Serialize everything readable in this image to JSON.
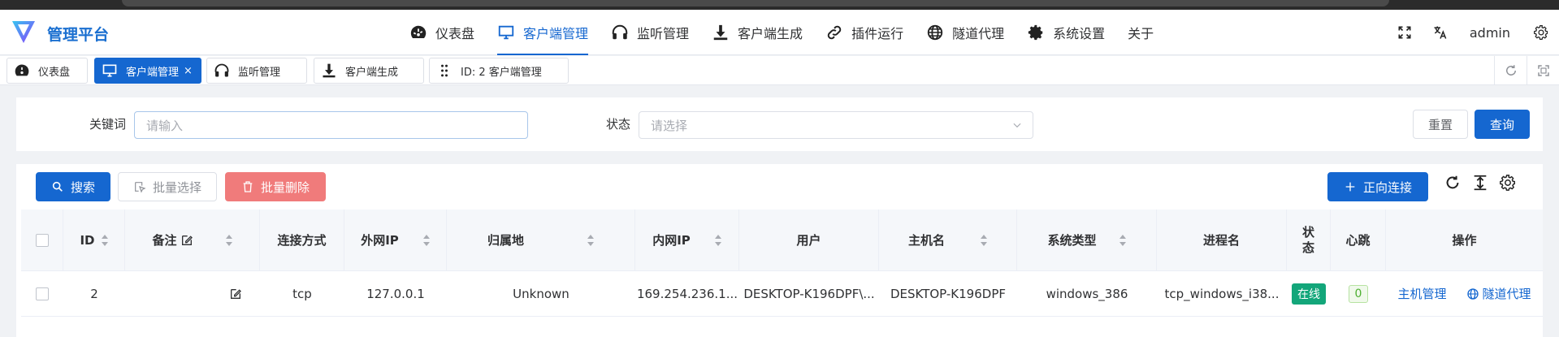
{
  "app": {
    "title": "管理平台"
  },
  "nav": [
    {
      "label": "仪表盘",
      "icon": "dashboard-icon"
    },
    {
      "label": "客户端管理",
      "icon": "monitor-icon",
      "active": true
    },
    {
      "label": "监听管理",
      "icon": "headphones-icon"
    },
    {
      "label": "客户端生成",
      "icon": "download-icon"
    },
    {
      "label": "插件运行",
      "icon": "link-icon"
    },
    {
      "label": "隧道代理",
      "icon": "globe-icon"
    },
    {
      "label": "系统设置",
      "icon": "gear-icon"
    },
    {
      "label": "关于"
    }
  ],
  "header_right": {
    "user": "admin"
  },
  "tabs": [
    {
      "label": "仪表盘",
      "icon": "dashboard-icon"
    },
    {
      "label": "客户端管理",
      "icon": "monitor-icon",
      "active": true,
      "close": "×"
    },
    {
      "label": "监听管理",
      "icon": "headphones-icon"
    },
    {
      "label": "客户端生成",
      "icon": "download-icon"
    },
    {
      "label": "ID: 2 客户端管理",
      "icon": "drag-icon"
    }
  ],
  "search_form": {
    "keyword_label": "关键词",
    "keyword_placeholder": "请输入",
    "status_label": "状态",
    "status_placeholder": "请选择",
    "reset_label": "重置",
    "query_label": "查询"
  },
  "toolbar": {
    "search_label": "搜索",
    "batch_select_label": "批量选择",
    "batch_delete_label": "批量删除",
    "forward_connect_label": "正向连接"
  },
  "table": {
    "columns": [
      "ID",
      "备注",
      "连接方式",
      "外网IP",
      "归属地",
      "内网IP",
      "用户",
      "主机名",
      "系统类型",
      "进程名",
      "状态",
      "心跳",
      "操作"
    ],
    "status_header_lines": [
      "状",
      "态"
    ],
    "rows": [
      {
        "id": "2",
        "remark": "",
        "conn": "tcp",
        "wan_ip": "127.0.0.1",
        "location": "Unknown",
        "lan_ip": "169.254.236.1...",
        "user": "DESKTOP-K196DPF\\...",
        "hostname": "DESKTOP-K196DPF",
        "os": "windows_386",
        "process": "tcp_windows_i38...",
        "status": "在线",
        "heartbeat": "0",
        "op_host": "主机管理",
        "op_tunnel": "隧道代理"
      }
    ]
  },
  "colors": {
    "primary": "#1567d0",
    "danger": "#f07b7b",
    "online": "#13a67a"
  }
}
